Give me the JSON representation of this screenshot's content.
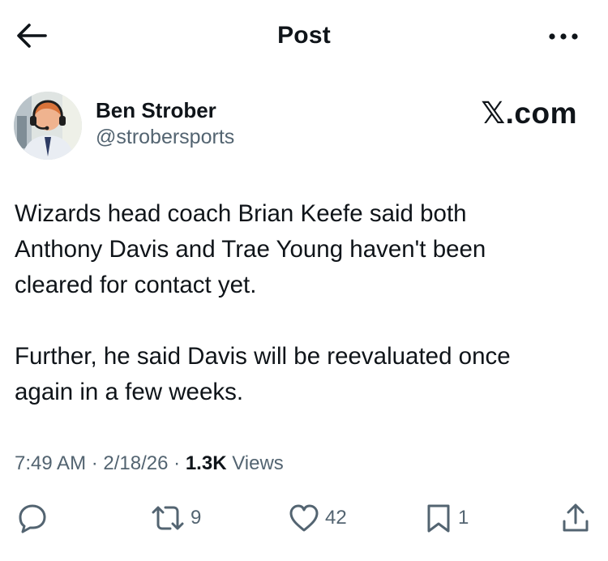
{
  "header": {
    "title": "Post"
  },
  "author": {
    "name": "Ben Strober",
    "handle": "@strobersports"
  },
  "brand": {
    "domain": ".com"
  },
  "tweet": {
    "lines": [
      "Wizards head coach Brian Keefe said both",
      "Anthony Davis and Trae Young haven't been",
      "cleared for contact yet.",
      "Further, he said Davis will be reevaluated once",
      "again in a few weeks."
    ]
  },
  "meta": {
    "time": "7:49 AM",
    "separator": "·",
    "date": "2/18/26",
    "views_count": "1.3K",
    "views_label": "Views"
  },
  "actions": {
    "reposts": "9",
    "likes": "42",
    "bookmarks": "1"
  },
  "icons": {
    "back": "arrow-left-icon",
    "more": "more-dots-icon",
    "reply": "reply-bubble-icon",
    "repost": "repost-icon",
    "like": "heart-icon",
    "bookmark": "bookmark-icon",
    "share": "share-icon"
  },
  "colors": {
    "text": "#0f1419",
    "secondary": "#536471",
    "background": "#ffffff"
  }
}
